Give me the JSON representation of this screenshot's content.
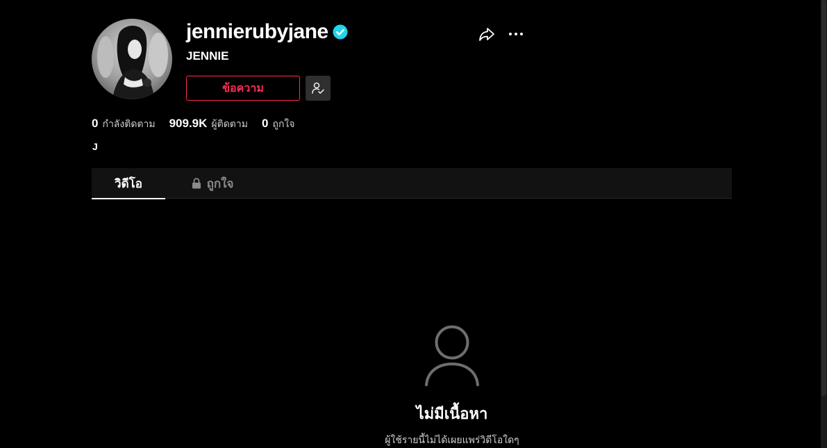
{
  "profile": {
    "username": "jennierubyjane",
    "display_name": "JENNIE",
    "bio": "J",
    "verified": true,
    "avatar_alt": "profile photo"
  },
  "actions": {
    "message_label": "ข้อความ",
    "friend_icon": "person-check-icon",
    "share_icon": "share-icon",
    "more_icon": "more-icon"
  },
  "stats": [
    {
      "value": "0",
      "label": "กำลังติดตาม"
    },
    {
      "value": "909.9K",
      "label": "ผู้ติดตาม"
    },
    {
      "value": "0",
      "label": "ถูกใจ"
    }
  ],
  "tabs": [
    {
      "label": "วิดีโอ",
      "active": true
    },
    {
      "label": "ถูกใจ",
      "active": false,
      "locked": true
    }
  ],
  "empty_state": {
    "title": "ไม่มีเนื้อหา",
    "subtitle": "ผู้ใช้รายนี้ไม่ได้เผยแพร่วิดีโอใดๆ"
  },
  "colors": {
    "accent": "#fe2c55",
    "verified": "#20d5ec",
    "background": "#000000"
  }
}
